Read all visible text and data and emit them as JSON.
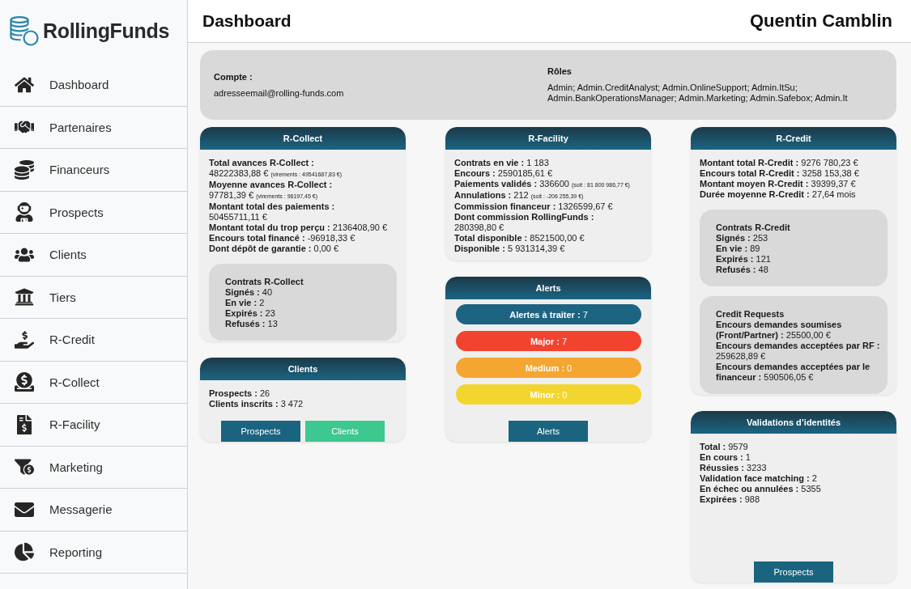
{
  "sidebar": {
    "logo": "RollingFunds",
    "items": [
      {
        "label": "Dashboard"
      },
      {
        "label": "Partenaires"
      },
      {
        "label": "Financeurs"
      },
      {
        "label": "Prospects"
      },
      {
        "label": "Clients"
      },
      {
        "label": "Tiers"
      },
      {
        "label": "R-Credit"
      },
      {
        "label": "R-Collect"
      },
      {
        "label": "R-Facility"
      },
      {
        "label": "Marketing"
      },
      {
        "label": "Messagerie"
      },
      {
        "label": "Reporting"
      }
    ]
  },
  "header": {
    "title": "Dashboard",
    "user": "Quentin Camblin"
  },
  "account": {
    "label": "Compte :",
    "email": "adresseemail@rolling-funds.com",
    "roles_label": "Rôles",
    "roles": "Admin; Admin.CreditAnalyst; Admin.OnlineSupport; Admin.ItSu; Admin.BankOperationsManager; Admin.Marketing; Admin.Safebox; Admin.It"
  },
  "columns": [
    {
      "cards": [
        {
          "kind": "stats",
          "title": "R-Collect",
          "lines": [
            {
              "label": "Total avances R-Collect :",
              "value": "48222383,88 €",
              "note": "(virements : 49541687,83 €)"
            },
            {
              "label": "Moyenne avances R-Collect :",
              "value": "97781,39 €",
              "note": "(virements : 96197,45 €)"
            },
            {
              "label": "Montant total des paiements :",
              "value": "50455711,11 €"
            },
            {
              "label": "Montant total du trop perçu :",
              "value": "2136408,90 €"
            },
            {
              "label": "Encours total financé :",
              "value": "-96918,33 €"
            },
            {
              "label": "Dont dépôt de garantie :",
              "value": "0,00 €"
            }
          ],
          "panels": [
            {
              "title": "Contrats R-Collect",
              "lines": [
                {
                  "label": "Signés :",
                  "value": "40"
                },
                {
                  "label": "En vie :",
                  "value": "2"
                },
                {
                  "label": "Expirés :",
                  "value": "23"
                },
                {
                  "label": "Refusés :",
                  "value": "13"
                }
              ]
            }
          ]
        },
        {
          "kind": "stats",
          "title": "Clients",
          "lines": [
            {
              "label": "Prospects :",
              "value": "26"
            },
            {
              "label": "Clients inscrits :",
              "value": "3 472"
            }
          ],
          "buttons": [
            {
              "label": "Prospects",
              "color": "#1b6480"
            },
            {
              "label": "Clients",
              "color": "#3cc88f"
            }
          ]
        }
      ]
    },
    {
      "cards": [
        {
          "kind": "stats",
          "title": "R-Facility",
          "lines": [
            {
              "label": "Contrats en vie :",
              "value": "1 183"
            },
            {
              "label": "Encours :",
              "value": "2590185,61 €"
            },
            {
              "label": "Paiements validés :",
              "value": "336600",
              "note": "(soit : 81 800 986,77 €)"
            },
            {
              "label": "Annulations :",
              "value": "212",
              "note": "(soit : -206 255,39 €)"
            },
            {
              "label": "Commission financeur :",
              "value": "1326599,67 €"
            },
            {
              "label": "Dont commission RollingFunds :",
              "value": "280398,80 €"
            },
            {
              "label": "Total disponible :",
              "value": "8521500,00 €"
            },
            {
              "label": "Disponible :",
              "value": "5 931314,39 €"
            }
          ]
        },
        {
          "kind": "alerts",
          "title": "Alerts",
          "alerts": [
            {
              "label": "Alertes à traiter :",
              "value": "7",
              "color": "#1d6482"
            },
            {
              "label": "Major :",
              "value": "7",
              "color": "#f2432f"
            },
            {
              "label": "Medium :",
              "value": "0",
              "color": "#f4a631"
            },
            {
              "label": "Minor :",
              "value": "0",
              "color": "#f3d52f"
            }
          ],
          "buttons": [
            {
              "label": "Alerts"
            }
          ]
        }
      ]
    },
    {
      "cards": [
        {
          "kind": "stats",
          "title": "R-Credit",
          "lines": [
            {
              "label": "Montant total R-Credit :",
              "value": "9276 780,23 €"
            },
            {
              "label": "Encours total R-Credit :",
              "value": "3258 153,38 €"
            },
            {
              "label": "Montant moyen R-Credit :",
              "value": "39399,37 €"
            },
            {
              "label": "Durée moyenne R-Credit :",
              "value": "27,64 mois"
            }
          ],
          "panels": [
            {
              "title": "Contrats R-Credit",
              "lines": [
                {
                  "label": "Signés :",
                  "value": "253"
                },
                {
                  "label": "En vie :",
                  "value": "89"
                },
                {
                  "label": "Expirés :",
                  "value": "121"
                },
                {
                  "label": "Refusés :",
                  "value": "48"
                }
              ]
            },
            {
              "title": "Credit Requests",
              "lines": [
                {
                  "label": "Encours demandes soumises (Front/Partner) :",
                  "value": "25500,00 €"
                },
                {
                  "label": "Encours demandes acceptées par RF :",
                  "value": "259628,89 €"
                },
                {
                  "label": "Encours demandes acceptées par le financeur :",
                  "value": "590506,05 €"
                }
              ]
            }
          ]
        },
        {
          "kind": "stats",
          "title": "Validations d’identités",
          "lines": [
            {
              "label": "Total :",
              "value": "9579"
            },
            {
              "label": "En cours :",
              "value": "1"
            },
            {
              "label": "Réussies :",
              "value": "3233"
            },
            {
              "label": "Validation face matching :",
              "value": "2"
            },
            {
              "label": "En échec ou annulées :",
              "value": "5355"
            },
            {
              "label": "Expirées :",
              "value": "988"
            }
          ],
          "buttons": [
            {
              "label": "Prospects"
            }
          ]
        }
      ]
    }
  ]
}
